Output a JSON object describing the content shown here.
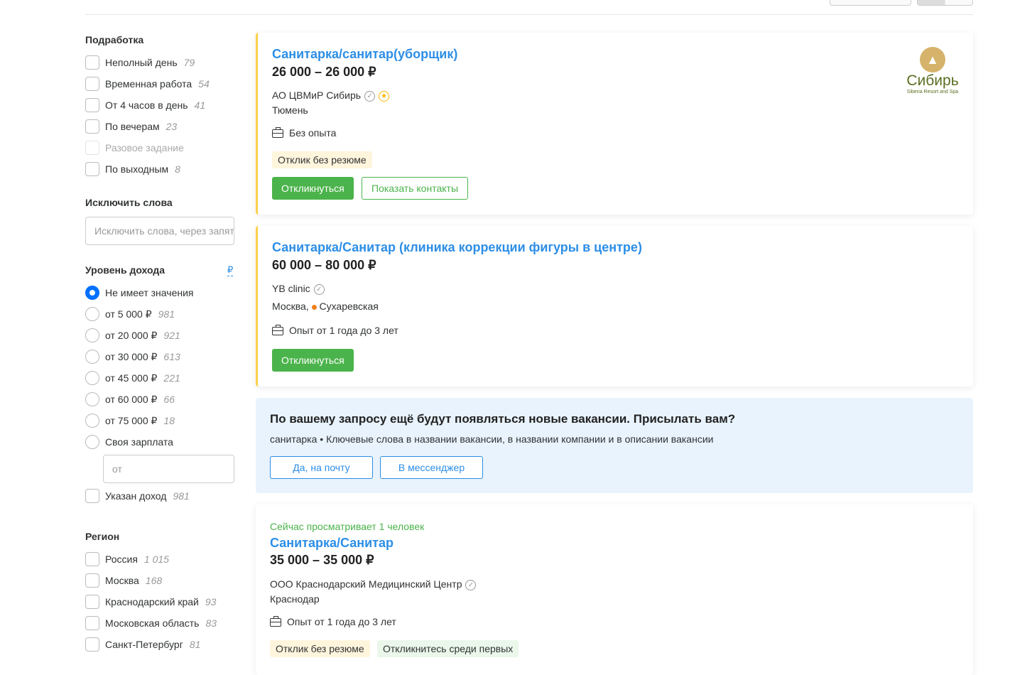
{
  "parttime": {
    "heading": "Подработка",
    "items": [
      {
        "label": "Неполный день",
        "count": "79"
      },
      {
        "label": "Временная работа",
        "count": "54"
      },
      {
        "label": "От 4 часов в день",
        "count": "41"
      },
      {
        "label": "По вечерам",
        "count": "23"
      },
      {
        "label": "Разовое задание",
        "count": ""
      },
      {
        "label": "По выходным",
        "count": "8"
      }
    ]
  },
  "exclude": {
    "heading": "Исключить слова",
    "placeholder": "Исключить слова, через запятую"
  },
  "income": {
    "heading": "Уровень дохода",
    "currency": "₽",
    "items": [
      {
        "label": "Не имеет значения",
        "count": ""
      },
      {
        "label": "от 5 000 ₽",
        "count": "981"
      },
      {
        "label": "от 20 000 ₽",
        "count": "921"
      },
      {
        "label": "от 30 000 ₽",
        "count": "613"
      },
      {
        "label": "от 45 000 ₽",
        "count": "221"
      },
      {
        "label": "от 60 000 ₽",
        "count": "66"
      },
      {
        "label": "от 75 000 ₽",
        "count": "18"
      },
      {
        "label": "Своя зарплата",
        "count": ""
      }
    ],
    "from_placeholder": "от",
    "specified": {
      "label": "Указан доход",
      "count": "981"
    }
  },
  "region": {
    "heading": "Регион",
    "items": [
      {
        "label": "Россия",
        "count": "1 015"
      },
      {
        "label": "Москва",
        "count": "168"
      },
      {
        "label": "Краснодарский край",
        "count": "93"
      },
      {
        "label": "Московская область",
        "count": "83"
      },
      {
        "label": "Санкт-Петербург",
        "count": "81"
      }
    ]
  },
  "vacancies": [
    {
      "title": "Санитарка/санитар(уборщик)",
      "salary": "26 000 – 26 000 ₽",
      "company": "АО ЦВМиР Сибирь",
      "city": "Тюмень",
      "experience": "Без опыта",
      "tags": [
        "Отклик без резюме"
      ],
      "respond": "Откликнуться",
      "contacts": "Показать контакты",
      "logo": {
        "name": "Сибирь",
        "sub": "Siberia Resort and Spa"
      }
    },
    {
      "title": "Санитарка/Санитар (клиника коррекции фигуры в центре)",
      "salary": "60 000 – 80 000 ₽",
      "company": "YB clinic",
      "city": "Москва,",
      "metro": "Сухаревская",
      "experience": "Опыт от 1 года до 3 лет",
      "respond": "Откликнуться"
    },
    {
      "viewing": "Сейчас просматривает 1 человек",
      "title": "Санитарка/Санитар",
      "salary": "35 000 – 35 000 ₽",
      "company": "ООО Краснодарский Медицинский Центр",
      "city": "Краснодар",
      "experience": "Опыт от 1 года до 3 лет",
      "tags": [
        "Отклик без резюме",
        "Откликнитесь среди первых"
      ]
    }
  ],
  "subscribe": {
    "title": "По вашему запросу ещё будут появляться новые вакансии. Присылать вам?",
    "desc": "санитарка • Ключевые слова в названии вакансии, в названии компании и в описании вакансии",
    "email": "Да, на почту",
    "messenger": "В мессенджер"
  }
}
